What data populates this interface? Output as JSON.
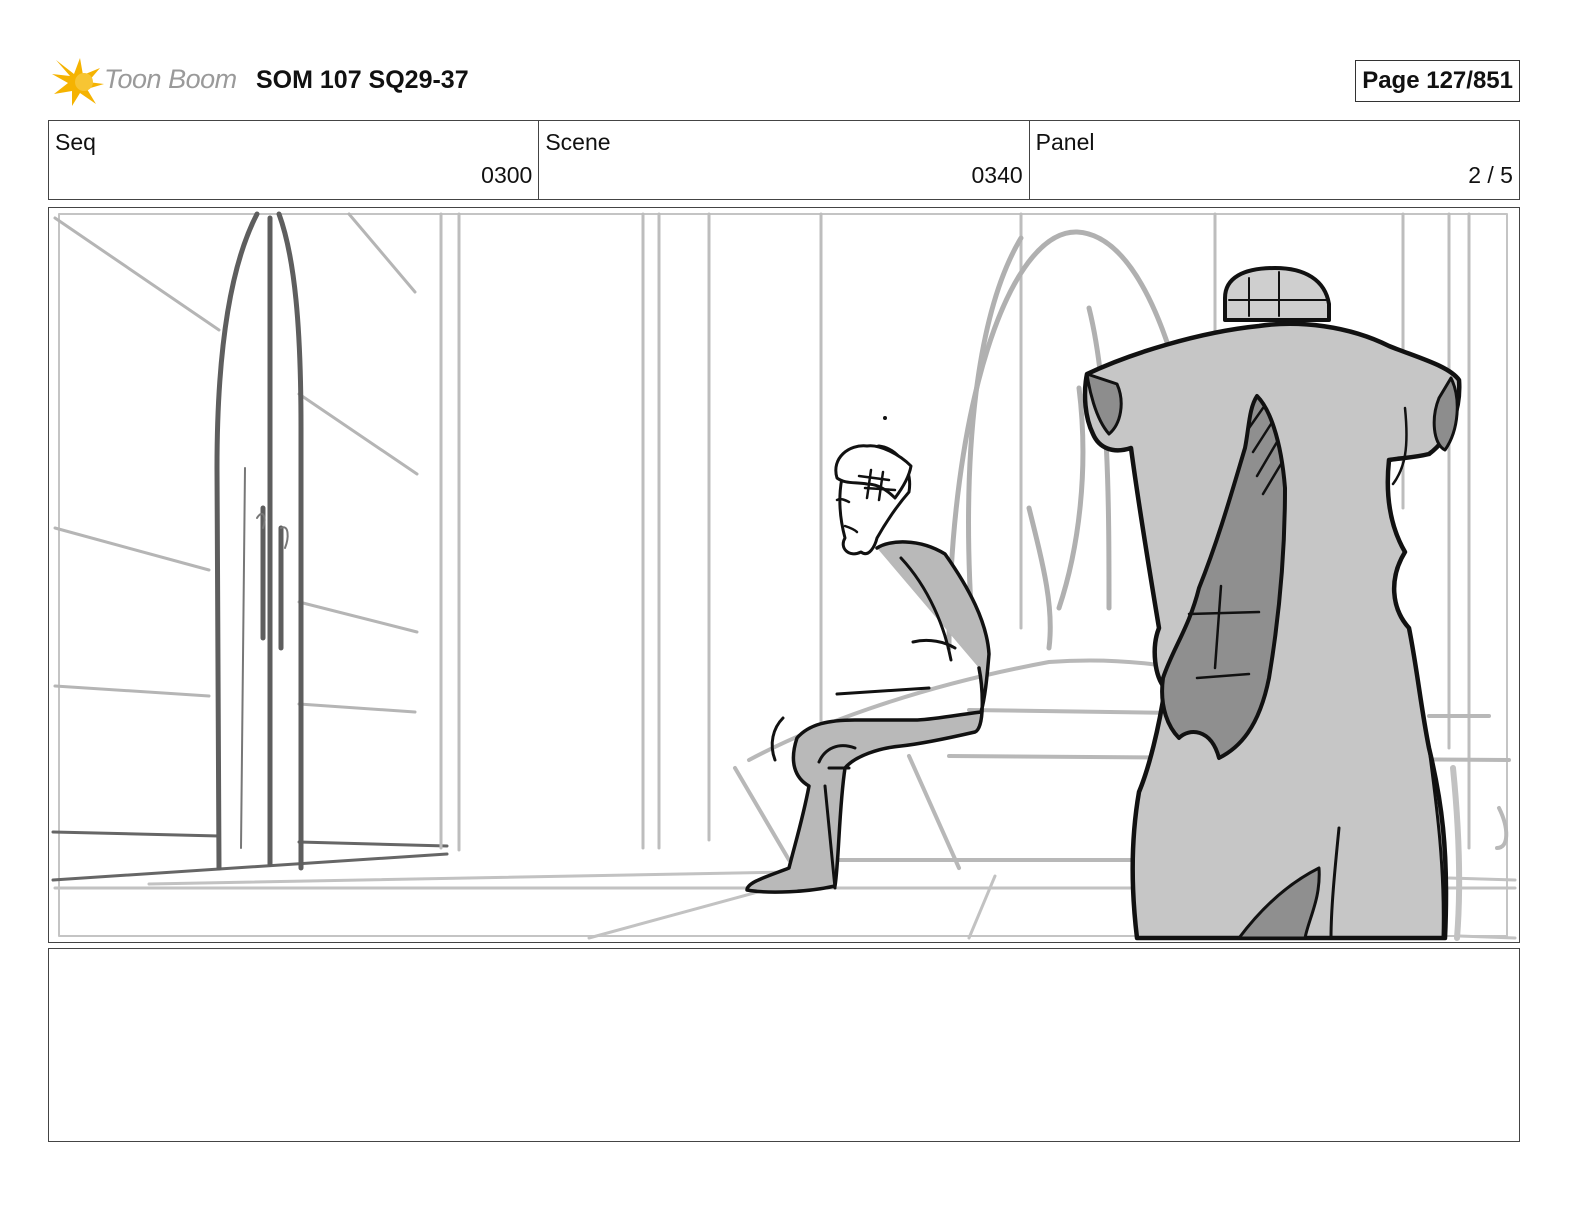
{
  "header": {
    "logo_text": "Toon Boom",
    "title": "SOM 107 SQ29-37",
    "page_label": "Page 127/851"
  },
  "info": {
    "seq_label": "Seq",
    "seq_value": "0300",
    "scene_label": "Scene",
    "scene_value": "0340",
    "panel_label": "Panel",
    "panel_value": "2 / 5"
  },
  "panel": {
    "image": "storyboard-sketch"
  },
  "notes": {
    "text": ""
  },
  "colors": {
    "logo_star": "#f5b301",
    "sketch_light": "#b8b8b8",
    "sketch_dark": "#111111",
    "fill_mid": "#bdbdbd",
    "fill_dark": "#8f8f8f"
  }
}
